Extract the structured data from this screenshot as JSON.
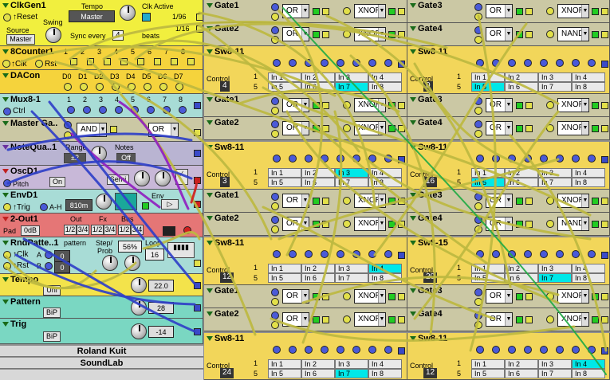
{
  "left_modules": {
    "clkgen": {
      "title": "ClkGen1",
      "reset": "↑Reset",
      "tempo_label": "Tempo",
      "tempo_value": "Master",
      "swing_label": "Swing",
      "clk_active_label": "Clk Active",
      "div1": "1/96",
      "div2": "1/16",
      "source_label": "Source",
      "source_value": "Master",
      "sync_label": "Sync every",
      "sync_value": "4",
      "beats_label": "beats"
    },
    "counter": {
      "title": "8Counter1",
      "clk": "↑Clk",
      "rst": "Rst",
      "steps": [
        "1",
        "2",
        "3",
        "4",
        "5",
        "6",
        "7",
        "8"
      ]
    },
    "dacon": {
      "title": "DACon",
      "bits": [
        "D0",
        "D1",
        "D2",
        "D3",
        "D4",
        "D5",
        "D6",
        "D7"
      ]
    },
    "mux": {
      "title": "Mux8-1",
      "ctrl": "Ctrl",
      "ins": [
        "1",
        "2",
        "3",
        "4",
        "5",
        "6",
        "7",
        "8"
      ]
    },
    "master_gate": {
      "title": "Master Ga..",
      "op1": "AND",
      "op2": "OR"
    },
    "note_quant": {
      "title": "NoteQua..1",
      "range_label": "Range",
      "range_value": "±2",
      "notes_label": "Notes",
      "notes_value": "Off"
    },
    "osc": {
      "title": "OscD1",
      "pitch": "Pitch",
      "on": "On",
      "semi": "Semi"
    },
    "env": {
      "title": "EnvD1",
      "trig": "↑Trig",
      "ah": "A-H",
      "time": "810m",
      "env_label": "Env"
    },
    "out": {
      "title": "2-Out1",
      "pad_label": "Pad",
      "pad_value": "0dB",
      "out_label": "Out",
      "fx_label": "Fx",
      "bus_label": "Bus",
      "pair": "1/2",
      "pair2": "3/4"
    },
    "rndpattern": {
      "title": "RndPatte..1",
      "pattern_label": "pattern",
      "step_label": "Step/",
      "prob_label": "Prob",
      "loop_label": "Loop",
      "prob_value": "56%",
      "loop_value": "16",
      "clk": "↑Clk",
      "rst": "↑Rst",
      "a_label": "A",
      "b_label": "B",
      "a_value": "0",
      "b_value": "0"
    },
    "tempo": {
      "title": "Tempo",
      "mode": "Uni",
      "value": "22.0"
    },
    "pattern": {
      "title": "Pattern",
      "mode": "BiP",
      "value": "28"
    },
    "trig": {
      "title": "Trig",
      "mode": "BiP",
      "value": "-14"
    },
    "footer1": "Roland Kuit",
    "footer2": "SoundLab"
  },
  "right_columns": [
    {
      "gates": [
        {
          "title": "Gate1",
          "op1": "OR",
          "op2": "XNOR"
        },
        {
          "title": "Gate2",
          "op1": "OR",
          "op2": "XNOR"
        }
      ],
      "sw": {
        "title": "Sw8-11",
        "control_label": "Control",
        "control": "4",
        "row1": [
          "In 1",
          "In 2",
          "In 3",
          "In 4"
        ],
        "row2": [
          "In 5",
          "In 6",
          "In 7",
          "In 8"
        ],
        "active": "In 7",
        "row_num1": "1",
        "row_num2": "5"
      },
      "gates2": [
        {
          "title": "Gate1",
          "op1": "OR",
          "op2": "XNOR"
        },
        {
          "title": "Gate2",
          "op1": "OR",
          "op2": "XNOR"
        }
      ],
      "sw2": {
        "title": "Sw8-11",
        "control_label": "Control",
        "control": "3",
        "active": "In 3"
      },
      "gates3": [
        {
          "title": "Gate1",
          "op1": "OR",
          "op2": "XNOR"
        },
        {
          "title": "Gate2",
          "op1": "OR",
          "op2": "XNOR"
        }
      ],
      "sw3": {
        "title": "Sw8-11",
        "control_label": "Control",
        "control": "12",
        "active": "In 4"
      },
      "gates4": [
        {
          "title": "Gate1",
          "op1": "OR",
          "op2": "XNOR"
        },
        {
          "title": "Gate2",
          "op1": "OR",
          "op2": "XNOR"
        }
      ],
      "sw4": {
        "title": "Sw8-11",
        "control_label": "Control",
        "control": "24",
        "active": "In 7"
      }
    },
    {
      "gates": [
        {
          "title": "Gate3",
          "op1": "OR",
          "op2": "XNOR"
        },
        {
          "title": "Gate4",
          "op1": "OR",
          "op2": "NAND"
        }
      ],
      "sw": {
        "title": "Sw8-11",
        "control_label": "Control",
        "control": "0",
        "active": "In 5"
      },
      "gates2": [
        {
          "title": "Gate3",
          "op1": "OR",
          "op2": "XNOR"
        },
        {
          "title": "Gate4",
          "op1": "OR",
          "op2": "XNOR"
        }
      ],
      "sw2": {
        "title": "Sw8-11",
        "control_label": "Control",
        "control": "16",
        "active": "In 5"
      },
      "gates3": [
        {
          "title": "Gate3",
          "op1": "OR",
          "op2": "XNOR"
        },
        {
          "title": "Gate4",
          "op1": "OR",
          "op2": "NAND"
        }
      ],
      "sw3": {
        "title": "Sw8-15",
        "control_label": "Control",
        "control": "20",
        "active": "In 7"
      },
      "gates4": [
        {
          "title": "Gate3",
          "op1": "OR",
          "op2": "XNOR"
        },
        {
          "title": "Gate4",
          "op1": "OR",
          "op2": "XNOR"
        }
      ],
      "sw4": {
        "title": "Sw8-11",
        "control_label": "Control",
        "control": "12",
        "active": "In 4"
      }
    }
  ],
  "colors": {
    "clkgen": "#f1ef3e",
    "counter": "#f5d33c",
    "dacon": "#f5d33c",
    "mux": "#a8dcd6",
    "gate": "#cbc8a4",
    "note": "#b9b4d2",
    "osc": "#c8b8d8",
    "env": "#a8dcd6",
    "out": "#e57676",
    "rnd": "#a8dcd6",
    "cv": "#f3e34b",
    "cv2": "#7ad7c2",
    "sw": "#f2d65a",
    "cable_y": "#bdb840",
    "cable_b": "#3040c8",
    "cable_p": "#9020c0",
    "cable_g": "#22aa44",
    "cable_r": "#d02020"
  }
}
